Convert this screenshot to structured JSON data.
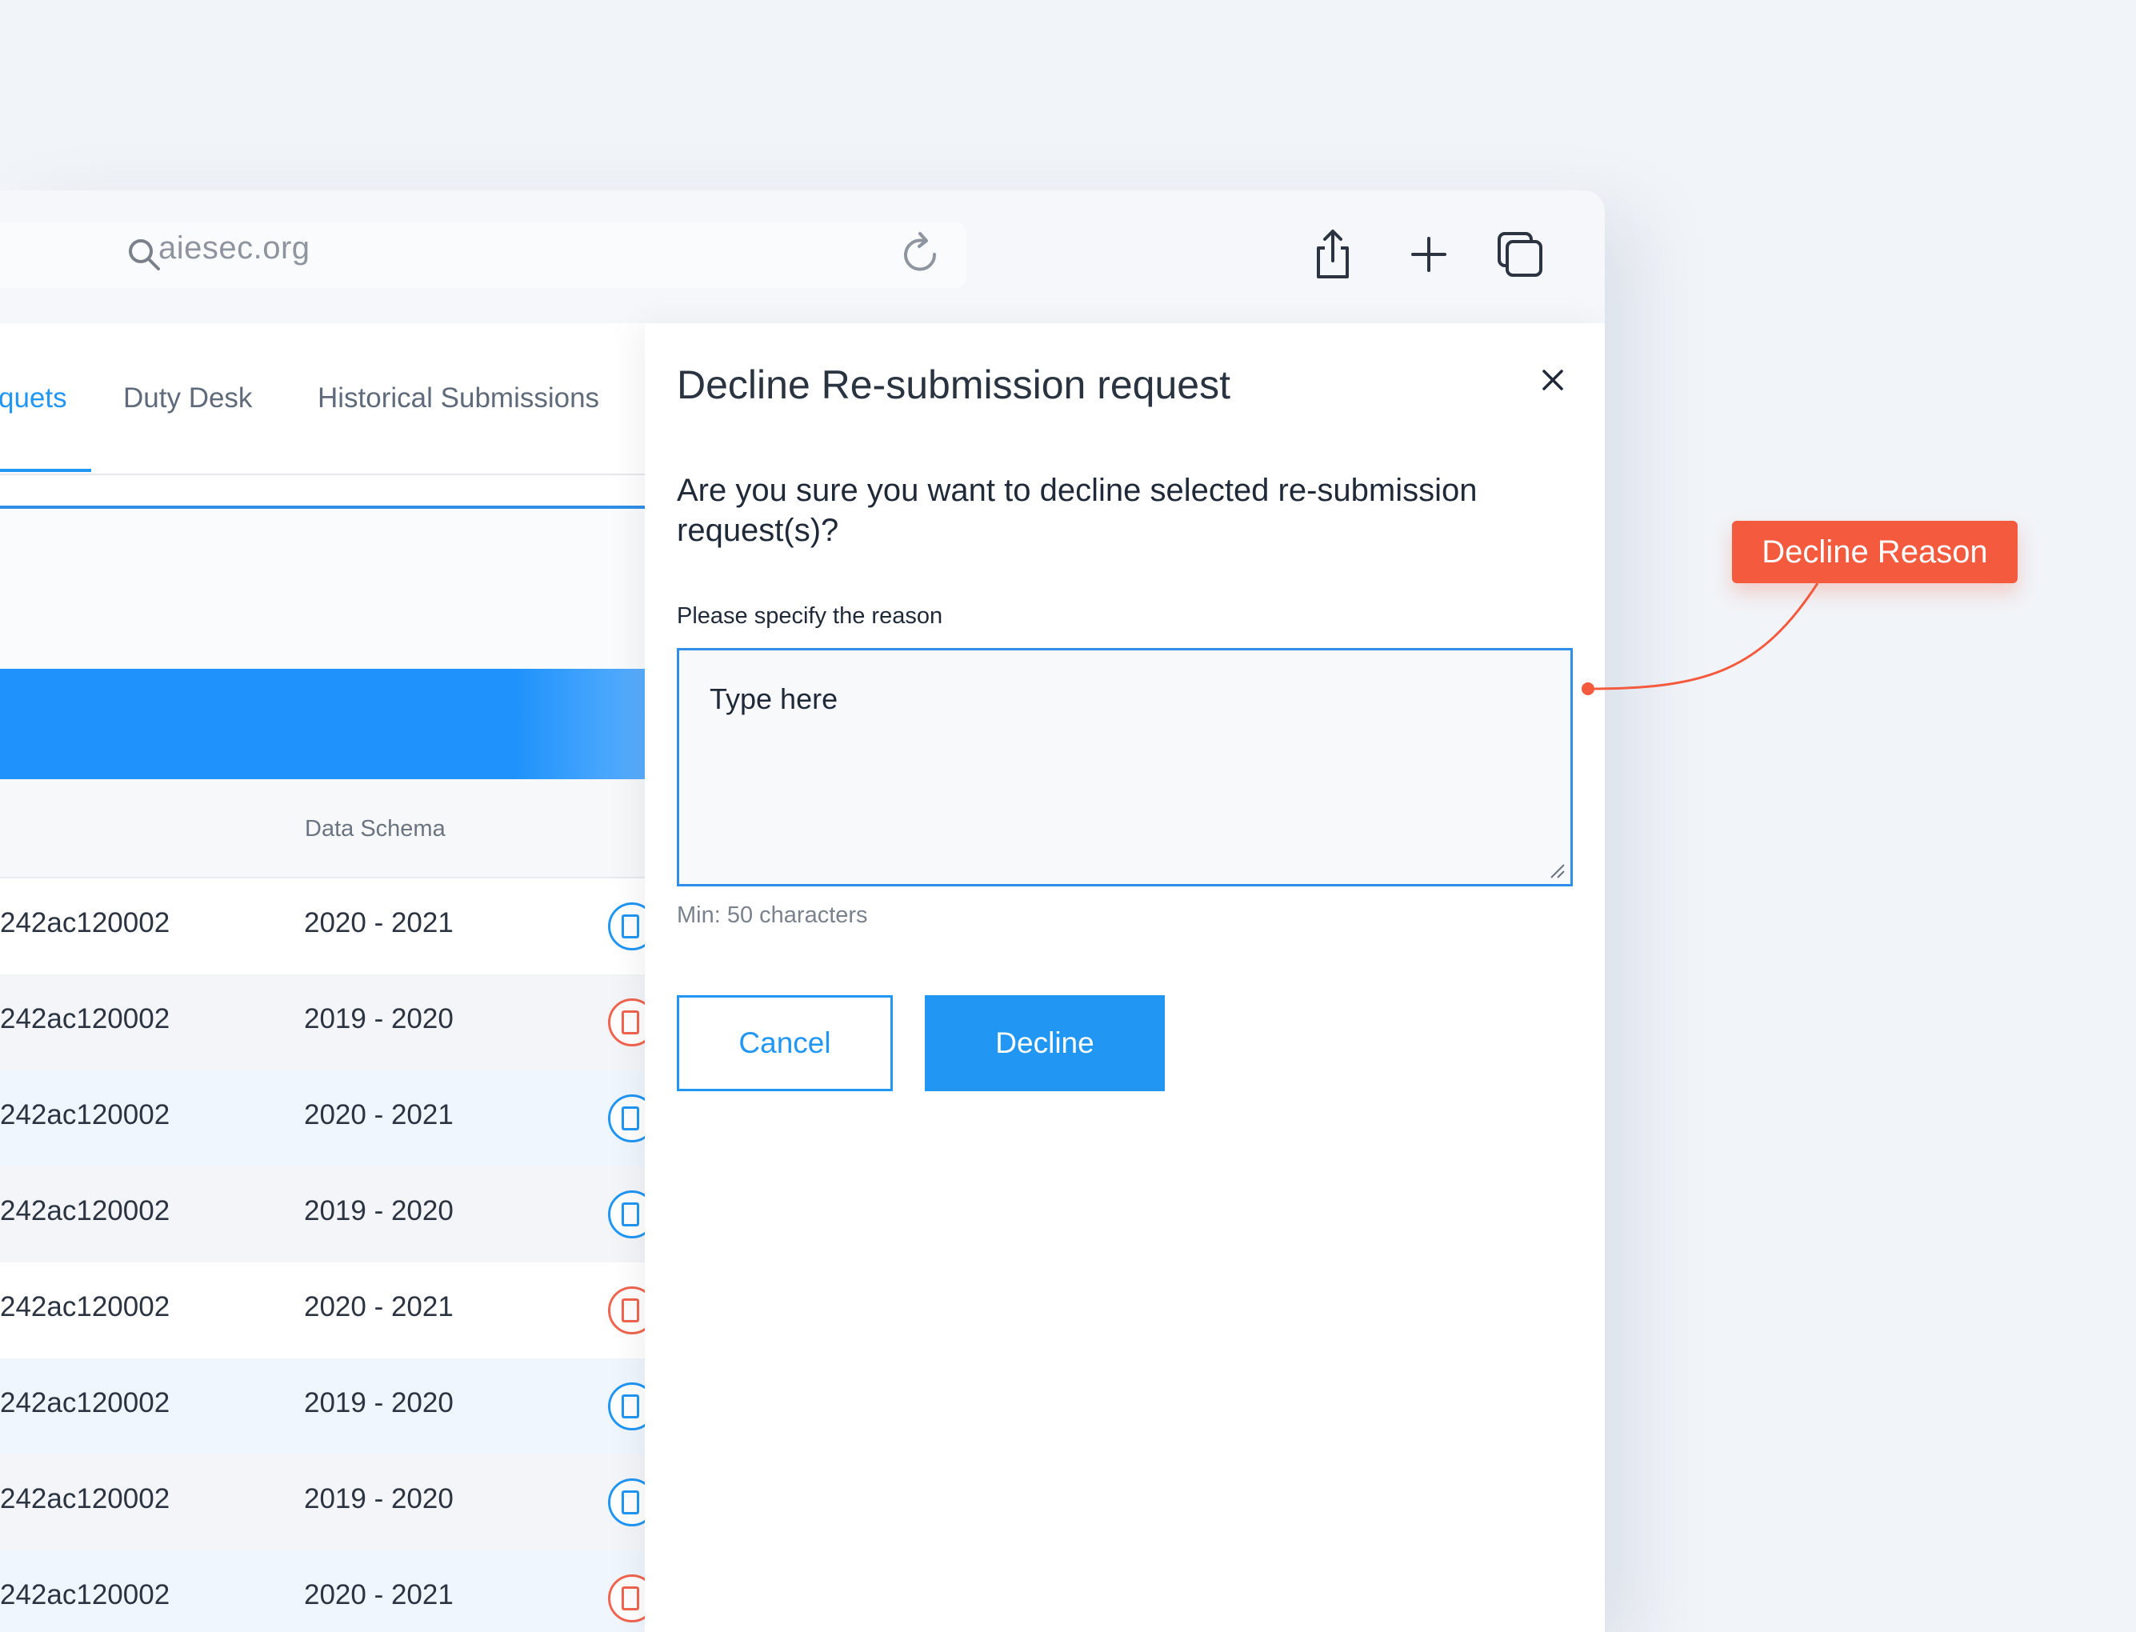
{
  "browser": {
    "url": "aiesec.org"
  },
  "tabs": [
    {
      "label": "quets",
      "active": true
    },
    {
      "label": "Duty Desk",
      "active": false
    },
    {
      "label": "Historical Submissions",
      "active": false
    }
  ],
  "table": {
    "columns": [
      "Data Schema"
    ],
    "rows": [
      {
        "id": "242ac120002",
        "schema": "2020 - 2021",
        "icon": "monitor-icon"
      },
      {
        "id": "242ac120002",
        "schema": "2019 - 2020",
        "icon": "document-icon"
      },
      {
        "id": "242ac120002",
        "schema": "2020 - 2021",
        "icon": "monitor-icon"
      },
      {
        "id": "242ac120002",
        "schema": "2019 - 2020",
        "icon": "monitor-icon"
      },
      {
        "id": "242ac120002",
        "schema": "2020 - 2021",
        "icon": "document-icon"
      },
      {
        "id": "242ac120002",
        "schema": "2019 - 2020",
        "icon": "monitor-icon"
      },
      {
        "id": "242ac120002",
        "schema": "2019 - 2020",
        "icon": "monitor-icon"
      },
      {
        "id": "242ac120002",
        "schema": "2020 - 2021",
        "icon": "document-icon"
      }
    ]
  },
  "modal": {
    "title": "Decline Re-submission request",
    "question": "Are you sure you want to decline selected re-submission request(s)?",
    "reason_label": "Please specify the reason",
    "reason_placeholder": "Type here",
    "min_hint": "Min: 50 characters",
    "cancel_label": "Cancel",
    "decline_label": "Decline"
  },
  "annotation": {
    "label": "Decline Reason"
  },
  "colors": {
    "accent": "#2196f3",
    "annotation": "#f35a3e",
    "background": "#f1f4f8"
  }
}
